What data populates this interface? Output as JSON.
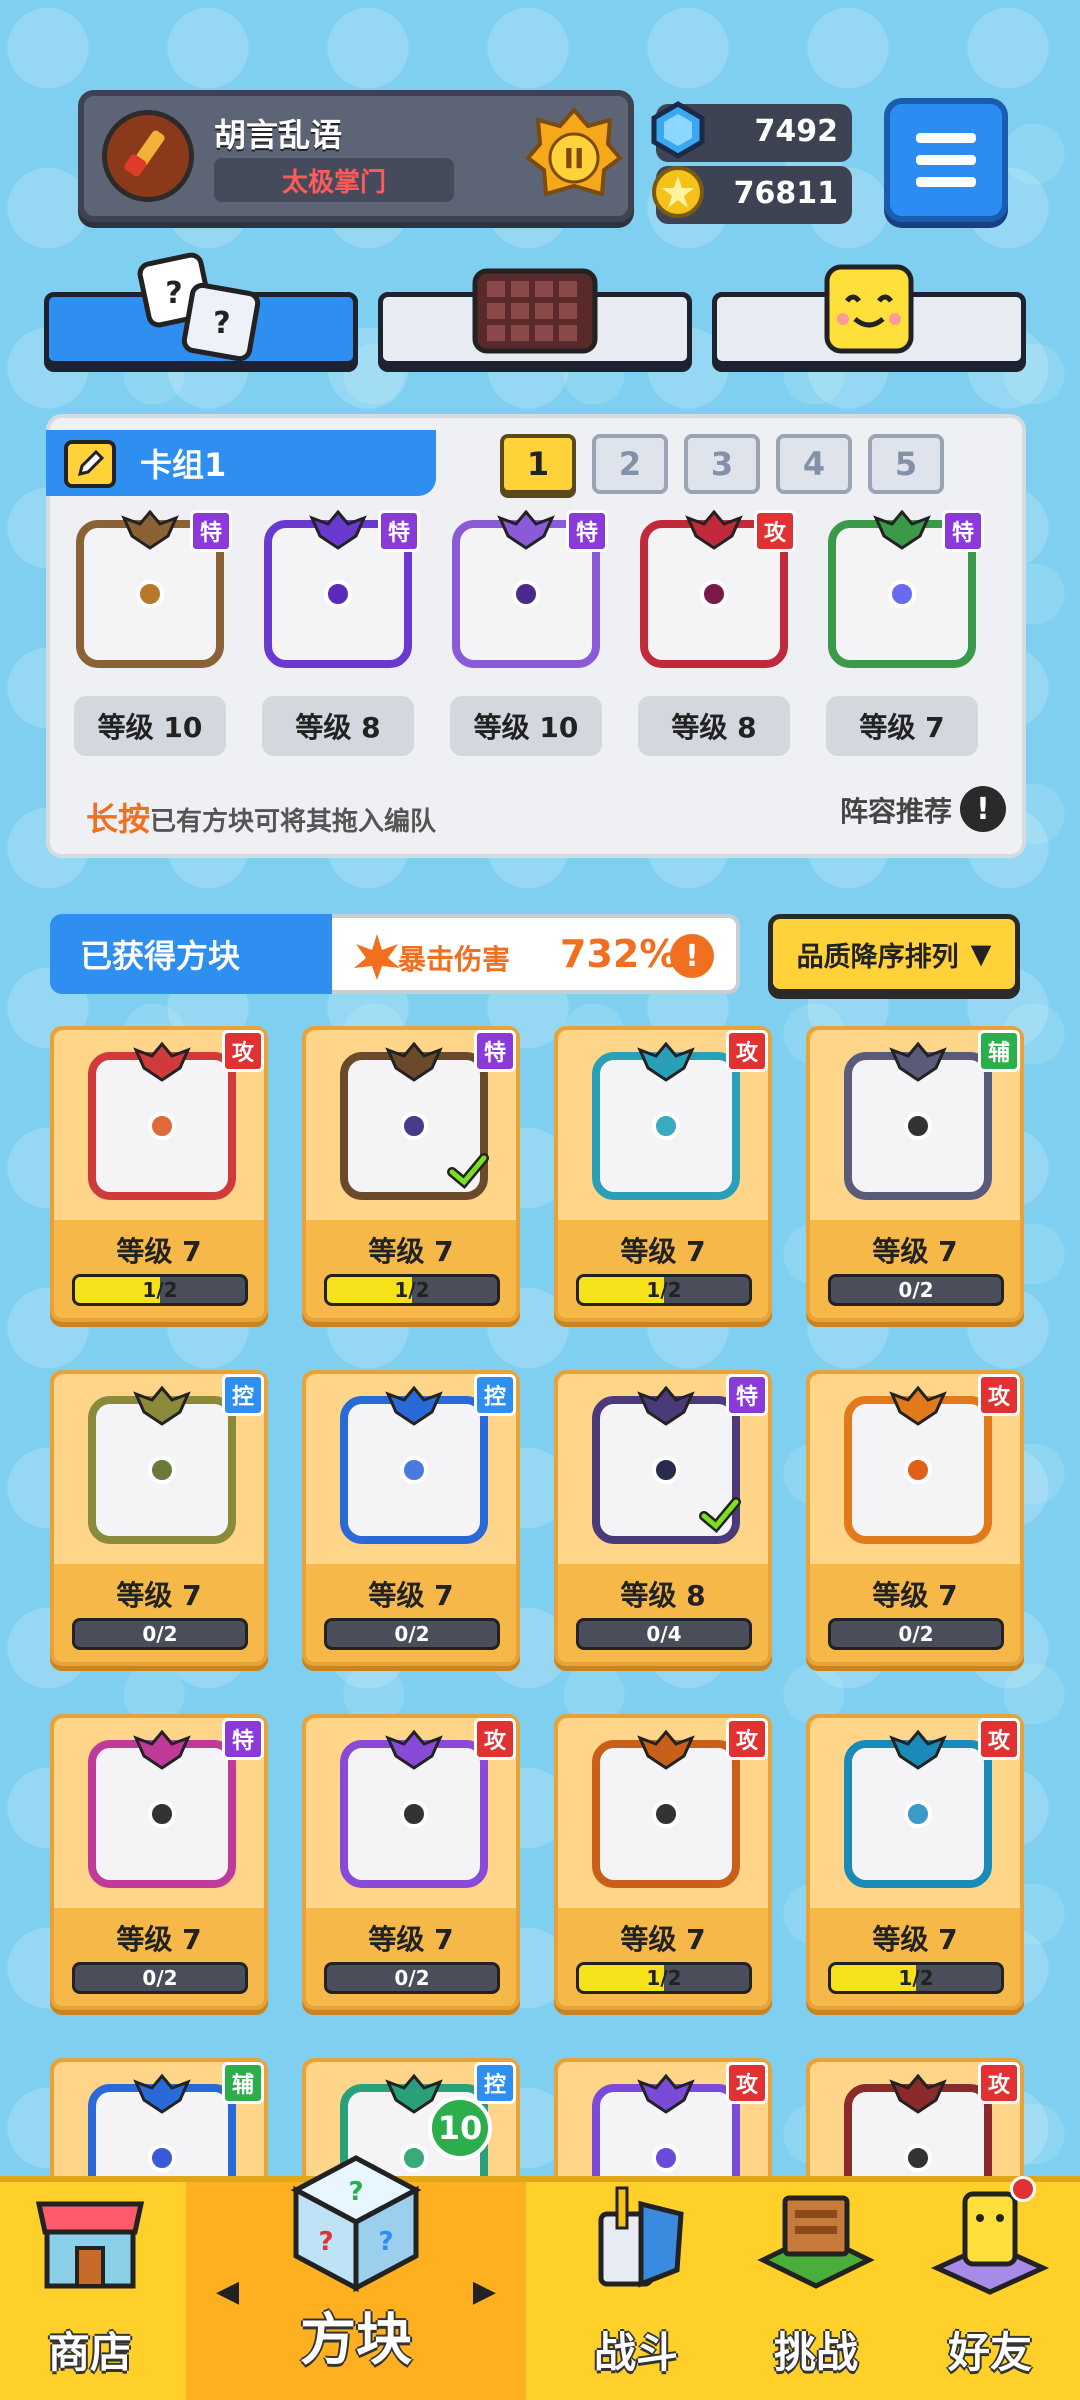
{
  "profile": {
    "username": "胡言乱语",
    "guild": "太极掌门",
    "rank": "II"
  },
  "currency": {
    "gems": "7492",
    "gold": "76811"
  },
  "top_tabs": [
    "dice-icon",
    "board-icon",
    "face-icon"
  ],
  "deck": {
    "title": "卡组1",
    "pages": [
      "1",
      "2",
      "3",
      "4",
      "5"
    ],
    "active_page": "1",
    "cards": [
      {
        "badge": "特",
        "type": "spc",
        "level": "等级 10",
        "frame": "#8a6236",
        "dot": "#b8782a"
      },
      {
        "badge": "特",
        "type": "spc",
        "level": "等级 8",
        "frame": "#6a3ad0",
        "dot": "#5a2ab8"
      },
      {
        "badge": "特",
        "type": "spc",
        "level": "等级 10",
        "frame": "#8a5ad8",
        "dot": "#4a2a8a"
      },
      {
        "badge": "攻",
        "type": "atk",
        "level": "等级 8",
        "frame": "#c02a3a",
        "dot": "#7a1a4a"
      },
      {
        "badge": "特",
        "type": "spc",
        "level": "等级 7",
        "frame": "#3a9a4a",
        "dot": "#6a6af0"
      }
    ],
    "hint_key": "长按",
    "hint_text": "已有方块可将其拖入编队",
    "lineup_label": "阵容推荐",
    "info_icon": "!"
  },
  "owned": {
    "title": "已获得方块",
    "crit_label": "暴击伤害",
    "crit_value": "732%",
    "info_icon": "!",
    "sort_label": "品质降序排列",
    "sort_arrow": "▼",
    "cards": [
      {
        "badge": "攻",
        "type": "atk",
        "level": "等级 7",
        "progress": "1/2",
        "fill": 0.5,
        "frame": "#d03a3a",
        "dot": "#e06a3a",
        "checked": false
      },
      {
        "badge": "特",
        "type": "spc",
        "level": "等级 7",
        "progress": "1/2",
        "fill": 0.5,
        "frame": "#6a4a2a",
        "dot": "#4a3a8a",
        "checked": true
      },
      {
        "badge": "攻",
        "type": "atk",
        "level": "等级 7",
        "progress": "1/2",
        "fill": 0.5,
        "frame": "#2aa0b8",
        "dot": "#3aaac0",
        "checked": false
      },
      {
        "badge": "辅",
        "type": "sup",
        "level": "等级 7",
        "progress": "0/2",
        "fill": 0,
        "frame": "#5a5a7a",
        "dot": "#333333",
        "checked": false
      },
      {
        "badge": "控",
        "type": "ctl",
        "level": "等级 7",
        "progress": "0/2",
        "fill": 0,
        "frame": "#8a8a3a",
        "dot": "#6a7a3a",
        "checked": false
      },
      {
        "badge": "控",
        "type": "ctl",
        "level": "等级 7",
        "progress": "0/2",
        "fill": 0,
        "frame": "#2a6ad8",
        "dot": "#4a7ae0",
        "checked": false
      },
      {
        "badge": "特",
        "type": "spc",
        "level": "等级 8",
        "progress": "0/4",
        "fill": 0,
        "frame": "#4a3a7a",
        "dot": "#2a2a4a",
        "checked": true
      },
      {
        "badge": "攻",
        "type": "atk",
        "level": "等级 7",
        "progress": "0/2",
        "fill": 0,
        "frame": "#e07a1a",
        "dot": "#e0601a",
        "checked": false
      },
      {
        "badge": "特",
        "type": "spc",
        "level": "等级 7",
        "progress": "0/2",
        "fill": 0,
        "frame": "#c03a9a",
        "dot": "#333333",
        "checked": false
      },
      {
        "badge": "攻",
        "type": "atk",
        "level": "等级 7",
        "progress": "0/2",
        "fill": 0,
        "frame": "#8a4ad8",
        "dot": "#333333",
        "checked": false
      },
      {
        "badge": "攻",
        "type": "atk",
        "level": "等级 7",
        "progress": "1/2",
        "fill": 0.5,
        "frame": "#c8601a",
        "dot": "#333333",
        "checked": false
      },
      {
        "badge": "攻",
        "type": "atk",
        "level": "等级 7",
        "progress": "1/2",
        "fill": 0.5,
        "frame": "#1a8ab8",
        "dot": "#3a9ac8",
        "checked": false
      },
      {
        "badge": "辅",
        "type": "sup",
        "level": "",
        "progress": "",
        "fill": 0,
        "frame": "#2a6ad8",
        "dot": "#3a5ad8",
        "checked": false
      },
      {
        "badge": "控",
        "type": "ctl",
        "level": "",
        "progress": "",
        "fill": 0,
        "frame": "#2aa07a",
        "dot": "#3aaa7a",
        "checked": false
      },
      {
        "badge": "攻",
        "type": "atk",
        "level": "",
        "progress": "",
        "fill": 0,
        "frame": "#7a4ad8",
        "dot": "#6a4ad8",
        "checked": false
      },
      {
        "badge": "攻",
        "type": "atk",
        "level": "",
        "progress": "",
        "fill": 0,
        "frame": "#8a2a2a",
        "dot": "#333333",
        "checked": false
      }
    ]
  },
  "nav": {
    "shop": "商店",
    "cube": "方块",
    "battle": "战斗",
    "challenge": "挑战",
    "friends": "好友",
    "cube_count": "10",
    "prev_arrow": "◀",
    "next_arrow": "▶"
  },
  "colors": {
    "accent": "#2e8ff0",
    "gold": "#ffd23a",
    "attack": "#e03232",
    "special": "#8a3ad8",
    "control": "#2e8ff0",
    "support": "#2cae4c"
  }
}
